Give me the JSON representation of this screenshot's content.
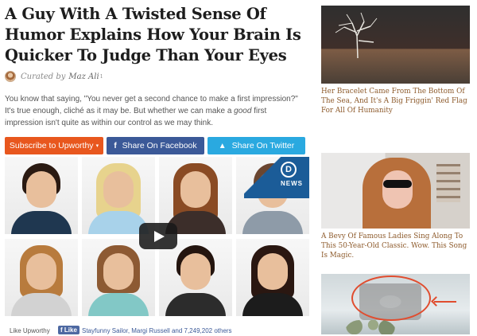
{
  "article": {
    "title": "A Guy With A Twisted Sense Of Humor Explains How Your Brain Is Quicker To Judge Than Your Eyes",
    "curated_label": "Curated by",
    "author": "Maz Ali",
    "lede_1": "You know that saying, \"You never get a second chance to make a first impression?\" It's true enough, cliché as it may be. But whether we can make a ",
    "lede_em": "good",
    "lede_2": " first impression isn't quite as within our control as we may think."
  },
  "share": {
    "upworthy": "Subscribe to Upworthy",
    "facebook": "Share On Facebook",
    "twitter": "Share On Twitter",
    "facebook_glyph": "f",
    "twitter_glyph": "🐦"
  },
  "video": {
    "channel": "NEWS",
    "logo": "D",
    "play_label": ""
  },
  "social": {
    "like_upworthy": "Like Upworthy",
    "like_button": "Like",
    "friends": "Stayfunny Sailor, Margi Russell and 7,249,202 others"
  },
  "sidebar": {
    "items": [
      {
        "caption": "Her Bracelet Came From The Bottom Of The Sea, And It's A Big Friggin' Red Flag For All Of Humanity"
      },
      {
        "caption": "A Bevy Of Famous Ladies Sing Along To This 50-Year-Old Classic. Wow. This Song Is Magic."
      },
      {
        "caption": ""
      }
    ]
  },
  "colors": {
    "upworthy_orange": "#e8571e",
    "facebook_blue": "#3b5998",
    "twitter_blue": "#2aa9e0",
    "caption_brown": "#8d5a2b"
  }
}
